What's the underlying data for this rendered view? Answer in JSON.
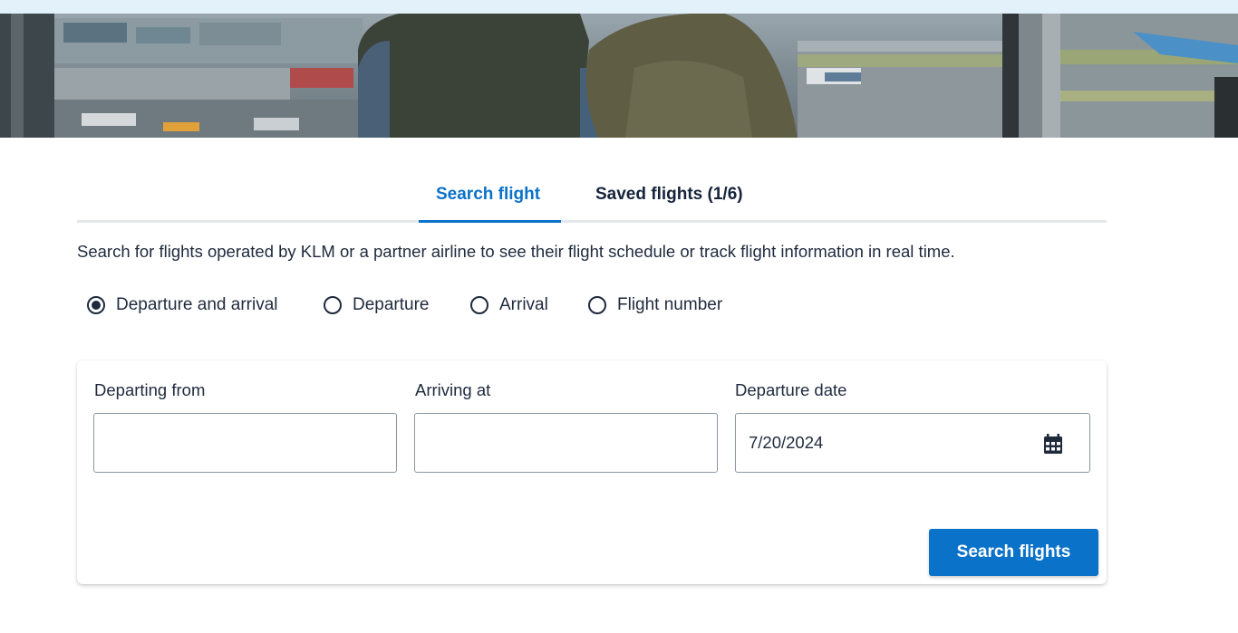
{
  "tabs": {
    "search_flight": "Search flight",
    "saved_flights": "Saved flights (1/6)",
    "active": "search_flight"
  },
  "intro_text": "Search for flights operated by KLM or a partner airline to see their flight schedule or track flight information in real time.",
  "search_type": {
    "selected": "departure_and_arrival",
    "options": [
      {
        "id": "departure_and_arrival",
        "label": "Departure and arrival"
      },
      {
        "id": "departure",
        "label": "Departure"
      },
      {
        "id": "arrival",
        "label": "Arrival"
      },
      {
        "id": "flight_number",
        "label": "Flight number"
      }
    ]
  },
  "form": {
    "departing_from": {
      "label": "Departing from",
      "value": ""
    },
    "arriving_at": {
      "label": "Arriving at",
      "value": ""
    },
    "departure_date": {
      "label": "Departure date",
      "value": "7/20/2024",
      "icon": "calendar-icon"
    }
  },
  "search_button_label": "Search flights",
  "colors": {
    "accent": "#0b72c9",
    "text": "#1f2a3d",
    "top_strip": "#e3f1fb"
  }
}
